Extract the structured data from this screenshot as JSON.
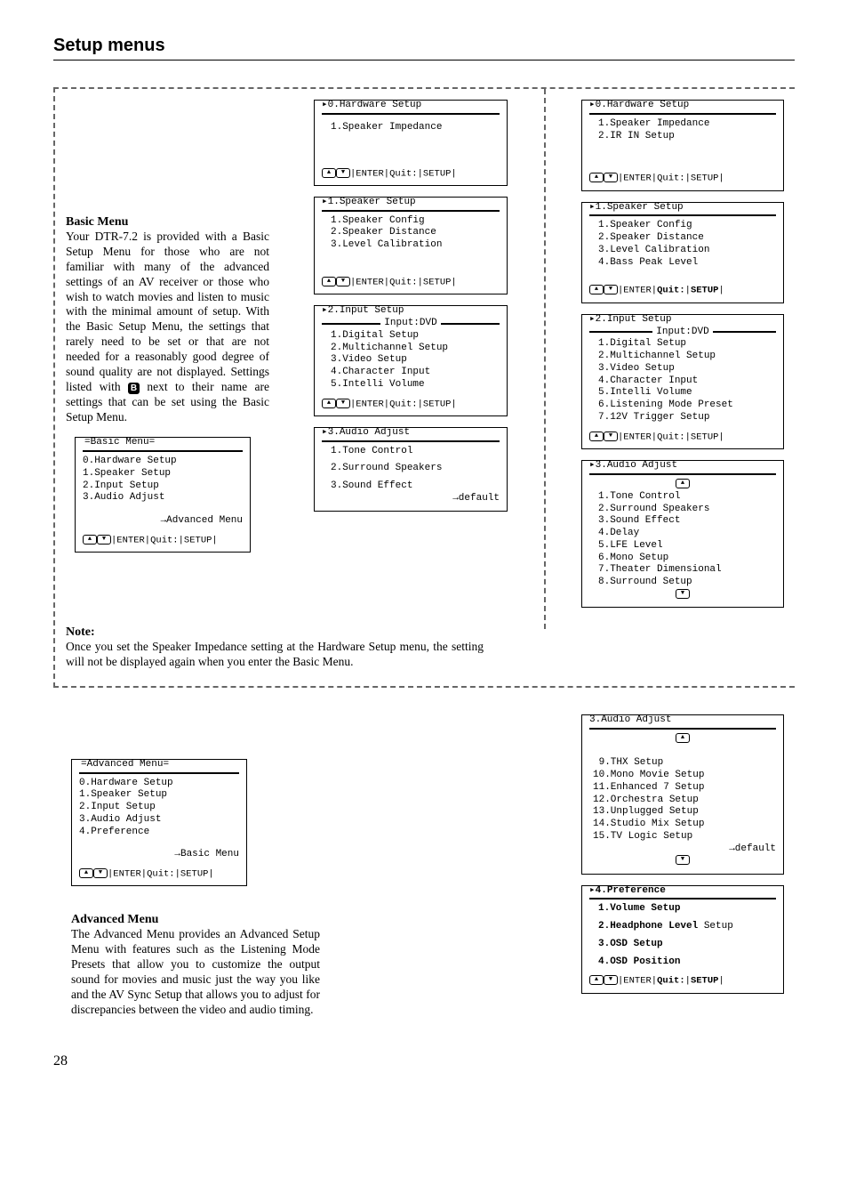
{
  "page": {
    "title": "Setup menus",
    "number": "28"
  },
  "basic": {
    "heading": "Basic Menu",
    "para": "Your DTR-7.2 is provided with a Basic Setup Menu for those who are not familiar with many of the advanced settings of an AV receiver or those who wish to watch movies and listen to music with the minimal amount of setup. With the Basic Setup Menu, the settings that rarely need to be set or that are not needed for a reasonably good degree of sound quality are not displayed. Settings listed with ",
    "para2": " next to their name are settings that can be set using the Basic Setup Menu.",
    "note_label": "Note:",
    "note_text": "Once you set the Speaker Impedance setting at the Hardware Setup menu, the setting will not be displayed again when you enter the Basic Menu.",
    "menu": {
      "title": "Basic Menu",
      "items": [
        "0.Hardware Setup",
        "1.Speaker Setup",
        "2.Input Setup",
        "3.Audio Adjust"
      ],
      "link": "→Advanced Menu",
      "footer": "|ENTER|Quit:|SETUP|"
    }
  },
  "advanced": {
    "heading": "Advanced Menu",
    "para": "The Advanced Menu provides an Advanced Setup Menu with features such as the Listening Mode Presets that allow you to customize the output sound for movies and music just the way you like and the AV Sync Setup that allows you to adjust for discrepancies between the video and audio timing.",
    "menu": {
      "title": "Advanced Menu",
      "items": [
        "0.Hardware Setup",
        "1.Speaker Setup",
        "2.Input Setup",
        "3.Audio Adjust",
        "4.Preference"
      ],
      "link": "→Basic Menu",
      "footer": "|ENTER|Quit:|SETUP|"
    }
  },
  "basic_panels": {
    "hw": {
      "title": "0.Hardware Setup",
      "items": [
        "1.Speaker Impedance"
      ],
      "footer": "|ENTER|Quit:|SETUP|"
    },
    "spk": {
      "title": "1.Speaker Setup",
      "items": [
        "1.Speaker Config",
        "2.Speaker Distance",
        "3.Level Calibration"
      ],
      "footer": "|ENTER|Quit:|SETUP|"
    },
    "input": {
      "title": "2.Input Setup",
      "sub": "Input:DVD",
      "items": [
        "1.Digital Setup",
        "2.Multichannel Setup",
        "3.Video Setup",
        "4.Character Input",
        "5.Intelli Volume"
      ],
      "footer": "|ENTER|Quit:|SETUP|"
    },
    "audio": {
      "title": "3.Audio Adjust",
      "items": [
        "1.Tone Control",
        "2.Surround Speakers",
        "3.Sound Effect"
      ],
      "link": "→default"
    }
  },
  "adv_panels": {
    "hw": {
      "title": "0.Hardware Setup",
      "items": [
        "1.Speaker Impedance",
        "2.IR IN Setup"
      ],
      "footer": "|ENTER|Quit:|SETUP|"
    },
    "spk": {
      "title": "1.Speaker Setup",
      "items": [
        "1.Speaker Config",
        "2.Speaker Distance",
        "3.Level Calibration",
        "4.Bass Peak Level"
      ],
      "footer": "|ENTER|Quit:|SETUP|",
      "footer_bold": "Quit:"
    },
    "input": {
      "title": "2.Input Setup",
      "sub": "Input:DVD",
      "items": [
        "1.Digital Setup",
        "2.Multichannel Setup",
        "3.Video Setup",
        "4.Character Input",
        "5.Intelli Volume",
        "6.Listening Mode Preset",
        "7.12V Trigger Setup"
      ],
      "footer": "|ENTER|Quit:|SETUP|"
    },
    "audio1": {
      "title": "3.Audio Adjust",
      "items": [
        "1.Tone Control",
        "2.Surround Speakers",
        "3.Sound Effect",
        "4.Delay",
        "5.LFE Level",
        "6.Mono Setup",
        "7.Theater Dimensional",
        "8.Surround Setup"
      ]
    },
    "audio2": {
      "title": "3.Audio Adjust",
      "items": [
        " 9.THX Setup",
        "10.Mono Movie Setup",
        "11.Enhanced 7 Setup",
        "12.Orchestra Setup",
        "13.Unplugged Setup",
        "14.Studio Mix Setup",
        "15.TV Logic Setup"
      ],
      "link": "→default"
    },
    "pref": {
      "title": "4.Preference",
      "items": [
        "1.Volume Setup",
        "2.Headphone Level Setup",
        "3.OSD Setup",
        "4.OSD Position"
      ],
      "footer": "|ENTER|Quit:|SETUP|"
    }
  }
}
